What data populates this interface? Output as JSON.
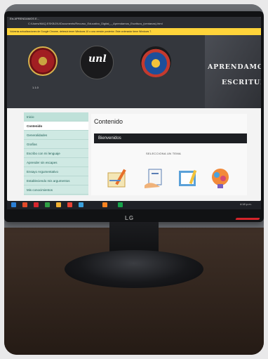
{
  "screen": {
    "window_title": "Eis APRENDAMOS E...",
    "address_bar": "C:/Users/MAQ.ESKB/2/U/Documents/Recurso_Educativo_Digital_-_Aprendamos_Escritura_(ventanas).html",
    "notice_bar": "Volverás actualizaciones de Google Chrome, debes/a tener Windows 10 o una versión posterior. Este ordenador tiene Windows 7.",
    "logo1_caption": "1.1.0",
    "logo2_text": "unl",
    "logo4_line1": "APRENDAMOS",
    "logo4_line2": "ESCRITURA",
    "sidebar": {
      "inicio": "Inicio",
      "contenido": "Contenido",
      "items": [
        "Generalidades",
        "Grafías",
        "Escribo con mi lenguaje",
        "Aprender sin escapes",
        "Ensayo Argumentativo",
        "Estableciendo mis argumentos",
        "Mis conocimientos"
      ]
    },
    "content_title": "Contenido",
    "bienvenidos": "Bienvenidos",
    "select_prompt": "SELECCIONA UN TEMA",
    "taskbar_time": "4:18 p.m."
  },
  "monitor": {
    "brand": "LG"
  },
  "colors": {
    "sidebar_bg": "#cfe9e3",
    "notice_yellow": "#ffd43a",
    "banner_dark": "#34373d",
    "accent_red": "#d4242a"
  }
}
